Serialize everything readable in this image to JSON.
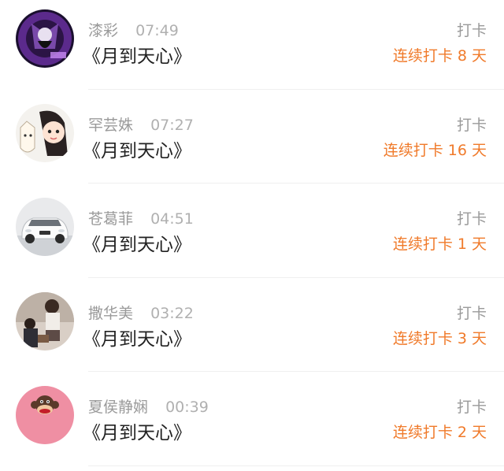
{
  "colors": {
    "meta_gray": "#9a9a9a",
    "title_black": "#222222",
    "streak_orange": "#f07a2a",
    "divider": "#efefef"
  },
  "items": [
    {
      "name": "漆彩",
      "time": "07:49",
      "title": "《月到天心》",
      "action": "打卡",
      "streak": "连续打卡 8 天",
      "avatar_icon": "avatar-anime-purple"
    },
    {
      "name": "罕芸姝",
      "time": "07:27",
      "title": "《月到天心》",
      "action": "打卡",
      "streak": "连续打卡 16 天",
      "avatar_icon": "avatar-cartoon-girl"
    },
    {
      "name": "苍葛菲",
      "time": "04:51",
      "title": "《月到天心》",
      "action": "打卡",
      "streak": "连续打卡 1 天",
      "avatar_icon": "avatar-white-car"
    },
    {
      "name": "撒华美",
      "time": "03:22",
      "title": "《月到天心》",
      "action": "打卡",
      "streak": "连续打卡 3 天",
      "avatar_icon": "avatar-photo-people"
    },
    {
      "name": "夏侯静娴",
      "time": "00:39",
      "title": "《月到天心》",
      "action": "打卡",
      "streak": "连续打卡 2 天",
      "avatar_icon": "avatar-monkey-pink"
    }
  ]
}
